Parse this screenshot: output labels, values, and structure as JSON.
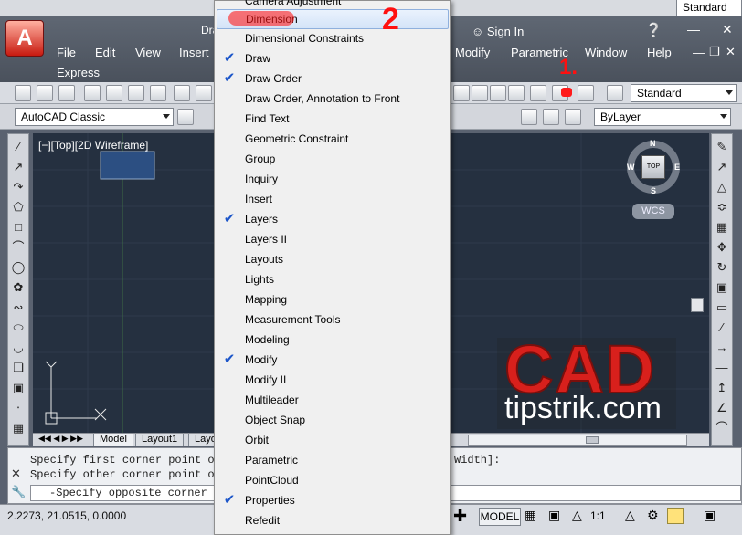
{
  "app": {
    "title_fragment": "Dra",
    "express_label": "Express",
    "sign_in": "Sign In",
    "style_combo": "Standard",
    "top_style_combo": "Standard"
  },
  "menubar": {
    "items": [
      "File",
      "Edit",
      "View",
      "Insert",
      "Modify",
      "Parametric",
      "Window",
      "Help"
    ]
  },
  "workspace": {
    "selected": "AutoCAD Classic"
  },
  "layer": {
    "selected": "ByLayer"
  },
  "viewport": {
    "label": "[−][Top][2D Wireframe]"
  },
  "viewcube": {
    "top": "TOP",
    "n": "N",
    "s": "S",
    "e": "E",
    "w": "W",
    "wcs": "WCS"
  },
  "tabs": {
    "model": "Model",
    "layout1": "Layout1",
    "layout2": "Layo"
  },
  "command": {
    "line1": "Specify first corner point or",
    "line2": "Specify other corner point or",
    "line1_tail": "Width]:",
    "prompt": "-Specify opposite corner o"
  },
  "status": {
    "coords": "2.2273, 21.0515, 0.0000",
    "model": "MODEL",
    "scale": "1:1"
  },
  "watermark": {
    "brand": "CAD",
    "site": "tipstrik.com"
  },
  "annotations": {
    "step1": "1.",
    "step2": "2"
  },
  "toolbar_menu": {
    "partial_top": "Camera Adjustment",
    "items": [
      {
        "label": "Dimension",
        "checked": false,
        "highlight": true
      },
      {
        "label": "Dimensional Constraints",
        "checked": false
      },
      {
        "label": "Draw",
        "checked": true
      },
      {
        "label": "Draw Order",
        "checked": true
      },
      {
        "label": "Draw Order, Annotation to Front",
        "checked": false
      },
      {
        "label": "Find Text",
        "checked": false
      },
      {
        "label": "Geometric Constraint",
        "checked": false
      },
      {
        "label": "Group",
        "checked": false
      },
      {
        "label": "Inquiry",
        "checked": false
      },
      {
        "label": "Insert",
        "checked": false
      },
      {
        "label": "Layers",
        "checked": true
      },
      {
        "label": "Layers II",
        "checked": false
      },
      {
        "label": "Layouts",
        "checked": false
      },
      {
        "label": "Lights",
        "checked": false
      },
      {
        "label": "Mapping",
        "checked": false
      },
      {
        "label": "Measurement Tools",
        "checked": false
      },
      {
        "label": "Modeling",
        "checked": false
      },
      {
        "label": "Modify",
        "checked": true
      },
      {
        "label": "Modify II",
        "checked": false
      },
      {
        "label": "Multileader",
        "checked": false
      },
      {
        "label": "Object Snap",
        "checked": false
      },
      {
        "label": "Orbit",
        "checked": false
      },
      {
        "label": "Parametric",
        "checked": false
      },
      {
        "label": "PointCloud",
        "checked": false
      },
      {
        "label": "Properties",
        "checked": true
      },
      {
        "label": "Refedit",
        "checked": false
      }
    ]
  }
}
